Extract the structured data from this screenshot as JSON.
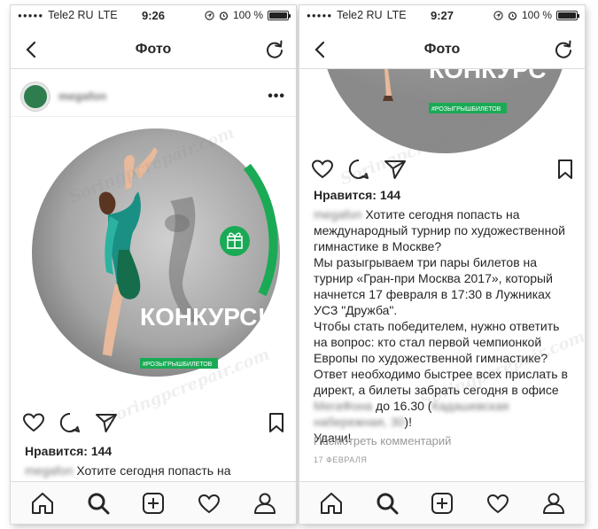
{
  "left": {
    "status": {
      "carrier": "Tele2 RU",
      "network": "LTE",
      "time": "9:26",
      "battery": "100 %",
      "battery_level": 1.0
    },
    "nav": {
      "title": "Фото"
    },
    "post": {
      "username": "megafon"
    },
    "image": {
      "headline": "КОНКУРС!",
      "tag": "#РОЗЫГРЫШБИЛЕТОВ"
    },
    "likes": "Нравится: 144",
    "caption_username": "megafon",
    "caption_start": " Хотите сегодня попасть на"
  },
  "right": {
    "status": {
      "carrier": "Tele2 RU",
      "network": "LTE",
      "time": "9:27",
      "battery": "100 %",
      "battery_level": 1.0
    },
    "nav": {
      "title": "Фото"
    },
    "image": {
      "headline": "КОНКУРС",
      "tag": "#РОЗЫГРЫШБИЛЕТОВ"
    },
    "likes": "Нравится: 144",
    "caption": {
      "username": "megafon",
      "line1": " Хотите сегодня попасть на международный турнир по художественной гимнастике в Москве?",
      "line2": "Мы разыгрываем три пары билетов на турнир «Гран-при Москва 2017», который начнется 17 февраля в 17:30 в Лужниках УСЗ \"Дружба\".",
      "line3": "Чтобы стать победителем, нужно ответить на вопрос: кто стал первой чемпионкой Европы по художественной гимнастике?",
      "line4a": "Ответ необходимо быстрее всех прислать в директ, а билеты забрать сегодня в офисе ",
      "line4_blur1": "МегаФона",
      "line4b": " до 16.30 (",
      "line4_blur2": "Кадашевская набережная, 30",
      "line4c": ")!",
      "line5": "Удачи!"
    },
    "comments_link": "Посмотреть комментарий",
    "date": "17 ФЕВРАЛЯ"
  },
  "watermark": "Soringpcrepair.com",
  "colors": {
    "accent_green": "#1aaa55",
    "text": "#262626",
    "muted": "#999999"
  }
}
